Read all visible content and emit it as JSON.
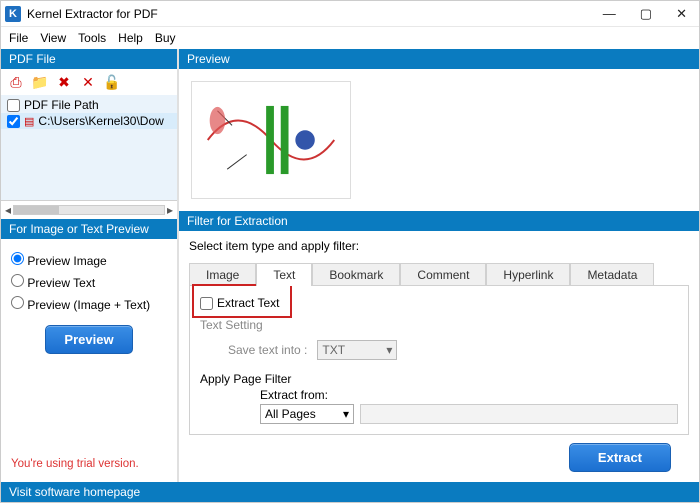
{
  "window": {
    "title": "Kernel Extractor for PDF"
  },
  "menu": {
    "file": "File",
    "view": "View",
    "tools": "Tools",
    "help": "Help",
    "buy": "Buy"
  },
  "left": {
    "header": "PDF File",
    "col_header": "PDF File Path",
    "files": [
      "C:\\Users\\Kernel30\\Dow"
    ],
    "preview_header": "For Image or Text Preview",
    "opt_image": "Preview Image",
    "opt_text": "Preview Text",
    "opt_both": "Preview (Image + Text)",
    "preview_btn": "Preview",
    "trial": "You're using trial version."
  },
  "right": {
    "preview_header": "Preview",
    "filter_header": "Filter for Extraction",
    "filter_instruction": "Select item type and apply filter:",
    "tabs": {
      "image": "Image",
      "text": "Text",
      "bookmark": "Bookmark",
      "comment": "Comment",
      "hyperlink": "Hyperlink",
      "metadata": "Metadata"
    },
    "extract_text_chk": "Extract Text",
    "text_setting": "Text Setting",
    "save_text_into": "Save text into :",
    "save_format": "TXT",
    "page_filter": "Apply Page Filter",
    "extract_from": "Extract from:",
    "extract_from_val": "All Pages",
    "extract_btn": "Extract"
  },
  "footer": "Visit software homepage"
}
